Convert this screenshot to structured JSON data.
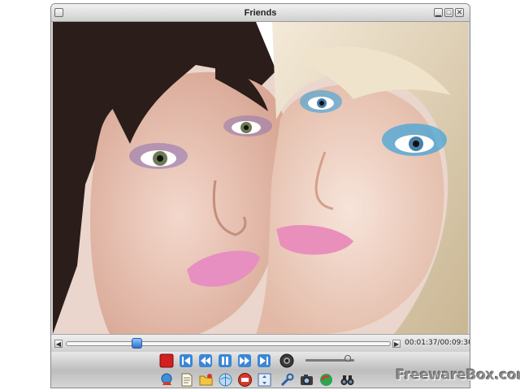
{
  "window": {
    "title": "Friends"
  },
  "video": {
    "description_icon": "video-frame"
  },
  "seekbar": {
    "position": 0.21,
    "time": "00:01:37/00:09:30"
  },
  "volume": {
    "level": 0.93
  },
  "controls": [
    {
      "name": "stop-button",
      "icon": "stop-icon"
    },
    {
      "name": "previous-button",
      "icon": "previous-icon"
    },
    {
      "name": "rewind-button",
      "icon": "rewind-icon"
    },
    {
      "name": "pause-button",
      "icon": "pause-icon"
    },
    {
      "name": "forward-button",
      "icon": "forward-icon"
    },
    {
      "name": "next-button",
      "icon": "next-icon"
    },
    {
      "name": "mute-button",
      "icon": "speaker-icon"
    }
  ],
  "toolbar": [
    {
      "name": "download-button",
      "icon": "globe-arrow-icon"
    },
    {
      "name": "playlist-button",
      "icon": "document-icon"
    },
    {
      "name": "open-folder-button",
      "icon": "folder-icon"
    },
    {
      "name": "internet-button",
      "icon": "globe-icon"
    },
    {
      "name": "subtitle-button",
      "icon": "sub-icon"
    },
    {
      "name": "fullscreen-button",
      "icon": "fullscreen-icon"
    },
    {
      "name": "tools-button",
      "icon": "wrench-icon"
    },
    {
      "name": "snapshot-button",
      "icon": "camera-icon"
    },
    {
      "name": "recycle-button",
      "icon": "recycle-icon"
    },
    {
      "name": "search-button",
      "icon": "binoculars-icon"
    }
  ],
  "watermark": "FreewareBox.com",
  "colors": {
    "accent": "#2f6fc8",
    "stop": "#d21f1f"
  }
}
